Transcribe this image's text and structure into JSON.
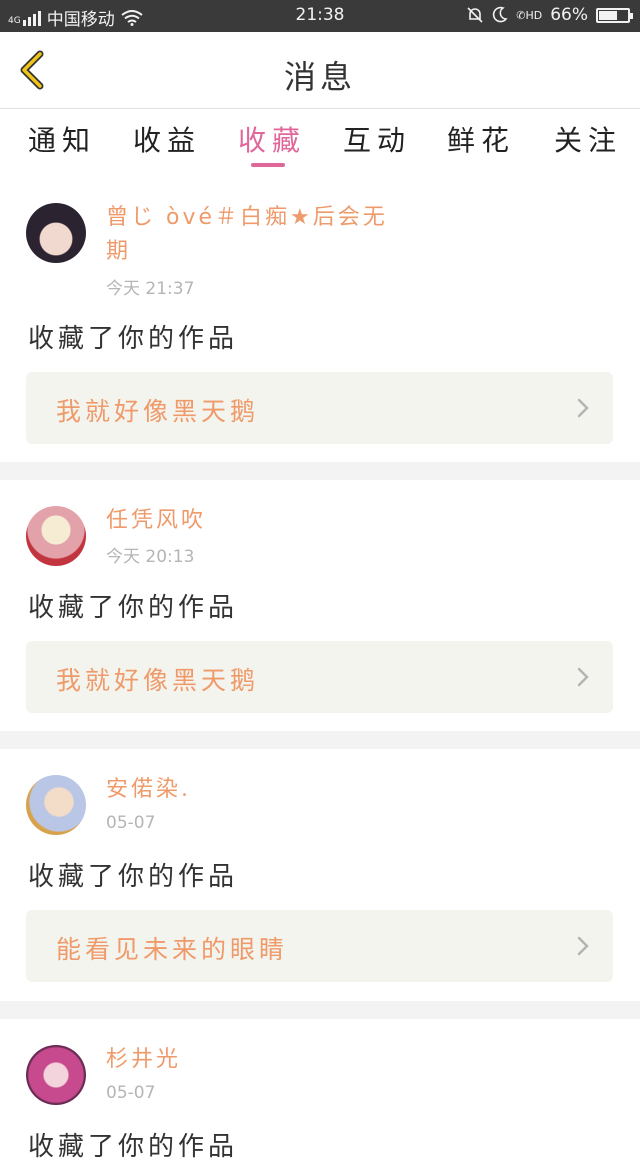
{
  "status_bar": {
    "signal": "4G",
    "carrier": "中国移动",
    "time": "21:38",
    "battery_pct": "66%",
    "battery_level": 0.66,
    "icons": [
      "signal-icon",
      "wifi-icon",
      "mute-bell-icon",
      "moon-icon",
      "hd-call-icon",
      "battery-icon"
    ]
  },
  "header": {
    "title": "消息",
    "back_icon": "chevron-left-icon",
    "accent_color": "#f0c419"
  },
  "tabs": [
    {
      "label": "通知"
    },
    {
      "label": "收益"
    },
    {
      "label": "收藏",
      "active": true
    },
    {
      "label": "互动"
    },
    {
      "label": "鲜花"
    },
    {
      "label": "关注"
    }
  ],
  "colors": {
    "accent_pink": "#e0679b",
    "username_orange": "#ef9a6a",
    "box_bg": "#f4f4ee"
  },
  "items": [
    {
      "username": "曾じ òvé＃白痴★后会无期",
      "time": "今天 21:37",
      "action": "收藏了你的作品",
      "work_title": "我就好像黑天鹅"
    },
    {
      "username": "任凭风吹",
      "time": "今天 20:13",
      "action": "收藏了你的作品",
      "work_title": "我就好像黑天鹅"
    },
    {
      "username": "安偌染.",
      "time": "05-07",
      "action": "收藏了你的作品",
      "work_title": "能看见未来的眼睛"
    },
    {
      "username": "杉井光",
      "time": "05-07",
      "action": "收藏了你的作品",
      "work_title": ""
    }
  ]
}
